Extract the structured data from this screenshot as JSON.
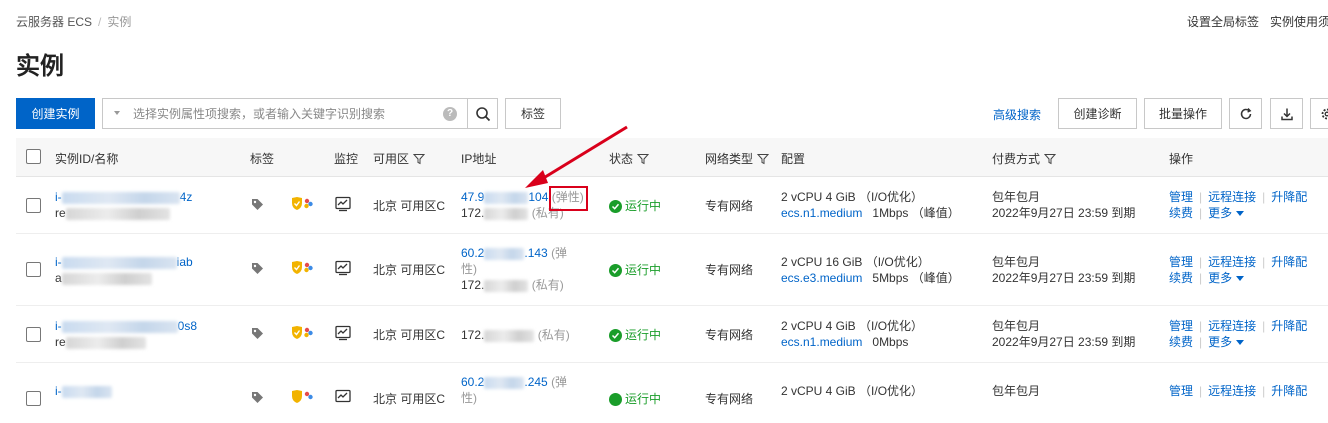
{
  "breadcrumb": {
    "parent": "云服务器 ECS",
    "current": "实例"
  },
  "top_links": {
    "global_tags": "设置全局标签",
    "usage_notice": "实例使用须知"
  },
  "page_title": "实例",
  "toolbar": {
    "create_label": "创建实例",
    "search_placeholder": "选择实例属性项搜索，或者输入关键字识别搜索",
    "tags_label": "标签",
    "advanced_search": "高级搜索",
    "create_diagnosis": "创建诊断",
    "batch_ops": "批量操作"
  },
  "columns": {
    "id_name": "实例ID/名称",
    "tags": "标签",
    "monitor": "监控",
    "zone": "可用区",
    "ip": "IP地址",
    "status": "状态",
    "network": "网络类型",
    "config": "配置",
    "billing": "付费方式",
    "actions": "操作"
  },
  "rows": [
    {
      "id_prefix": "i-",
      "id_suffix": "4z",
      "name_prefix": "re",
      "zone": "北京 可用区C",
      "ip_public_a": "47.9",
      "ip_public_b": "104",
      "ip_public_tag": "(弹性)",
      "ip_private_a": "172.",
      "ip_private_tag": "(私有)",
      "status": "运行中",
      "network": "专有网络",
      "config_main": "2 vCPU 4 GiB （I/O优化）",
      "config_type": "ecs.n1.medium",
      "bandwidth": "1Mbps （峰值）",
      "billing_type": "包年包月",
      "expire": "2022年9月27日 23:59 到期",
      "ops": [
        "管理",
        "远程连接",
        "升降配"
      ],
      "ops2": [
        "续费",
        "更多"
      ]
    },
    {
      "id_prefix": "i-",
      "id_suffix": "iab",
      "name_prefix": "a",
      "zone": "北京 可用区C",
      "ip_public_a": "60.2",
      "ip_public_b": ".143",
      "ip_public_tag": "(弹",
      "ip_public_tag2": "性)",
      "ip_private_a": "172.",
      "ip_private_tag": "(私有)",
      "status": "运行中",
      "network": "专有网络",
      "config_main": "2 vCPU 16 GiB （I/O优化）",
      "config_type": "ecs.e3.medium",
      "bandwidth": "5Mbps （峰值）",
      "billing_type": "包年包月",
      "expire": "2022年9月27日 23:59 到期",
      "ops": [
        "管理",
        "远程连接",
        "升降配"
      ],
      "ops2": [
        "续费",
        "更多"
      ]
    },
    {
      "id_prefix": "i-",
      "id_suffix": "0s8",
      "name_prefix": "re",
      "zone": "北京 可用区C",
      "ip_private_a": "172.",
      "ip_private_tag": "(私有)",
      "status": "运行中",
      "network": "专有网络",
      "config_main": "2 vCPU 4 GiB （I/O优化）",
      "config_type": "ecs.n1.medium",
      "bandwidth": "0Mbps",
      "billing_type": "包年包月",
      "expire": "2022年9月27日 23:59 到期",
      "ops": [
        "管理",
        "远程连接",
        "升降配"
      ],
      "ops2": [
        "续费",
        "更多"
      ]
    },
    {
      "id_prefix": "i-",
      "zone": "北京 可用区C",
      "ip_public_a": "60.2",
      "ip_public_b": ".245",
      "ip_public_tag": "(弹",
      "ip_public_tag2": "性)",
      "status": "运行中",
      "network": "专有网络",
      "config_main": "2 vCPU 4 GiB （I/O优化）",
      "billing_type": "包年包月",
      "ops": [
        "管理",
        "远程连接",
        "升降配"
      ]
    }
  ],
  "colors": {
    "primary": "#0064c8",
    "running": "#1a9d2a",
    "annotation": "#d9001b"
  }
}
